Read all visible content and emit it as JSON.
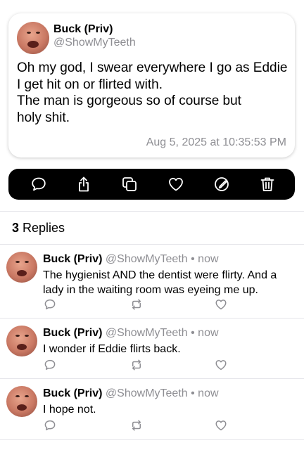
{
  "post": {
    "author_name": "Buck (Priv)",
    "author_handle": "@ShowMyTeeth",
    "text_lines": [
      "Oh my god, I swear everywhere I go as Eddie",
      "I get hit on or flirted with.",
      "The man is gorgeous so of course but",
      "holy shit."
    ],
    "timestamp": "Aug 5, 2025 at 10:35:53 PM"
  },
  "action_bar": {
    "icons": [
      "reply-icon",
      "share-icon",
      "copy-icon",
      "like-icon",
      "edit-icon",
      "delete-icon"
    ]
  },
  "replies_section": {
    "count": "3",
    "label": "Replies"
  },
  "replies": [
    {
      "author_name": "Buck (Priv)",
      "author_handle": "@ShowMyTeeth",
      "separator": "•",
      "time": "now",
      "text_lines": [
        "The hygienist AND the dentist were flirty. And a",
        "lady in the waiting room was eyeing me up."
      ]
    },
    {
      "author_name": "Buck (Priv)",
      "author_handle": "@ShowMyTeeth",
      "separator": "•",
      "time": "now",
      "text_lines": [
        "I wonder if Eddie flirts back."
      ]
    },
    {
      "author_name": "Buck (Priv)",
      "author_handle": "@ShowMyTeeth",
      "separator": "•",
      "time": "now",
      "text_lines": [
        "I hope not."
      ]
    }
  ],
  "colors": {
    "secondary_text": "#8e8e93",
    "action_bar_bg": "#000000",
    "divider": "#e5e5ea"
  }
}
